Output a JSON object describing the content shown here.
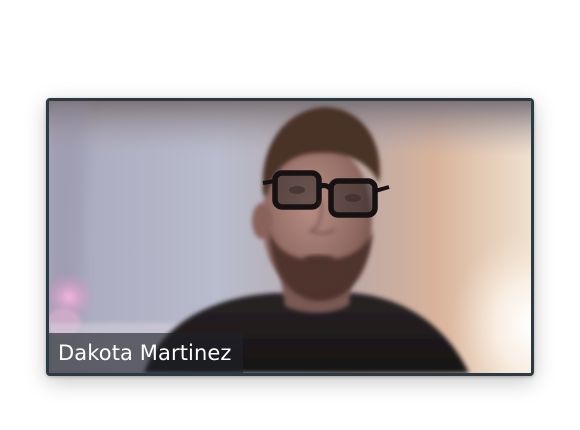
{
  "participant": {
    "name": "Dakota Martinez",
    "video_on": true
  },
  "colors": {
    "tile_border": "#2c3a44",
    "label_background": "rgba(30,34,40,0.62)",
    "label_text": "#ffffff"
  }
}
